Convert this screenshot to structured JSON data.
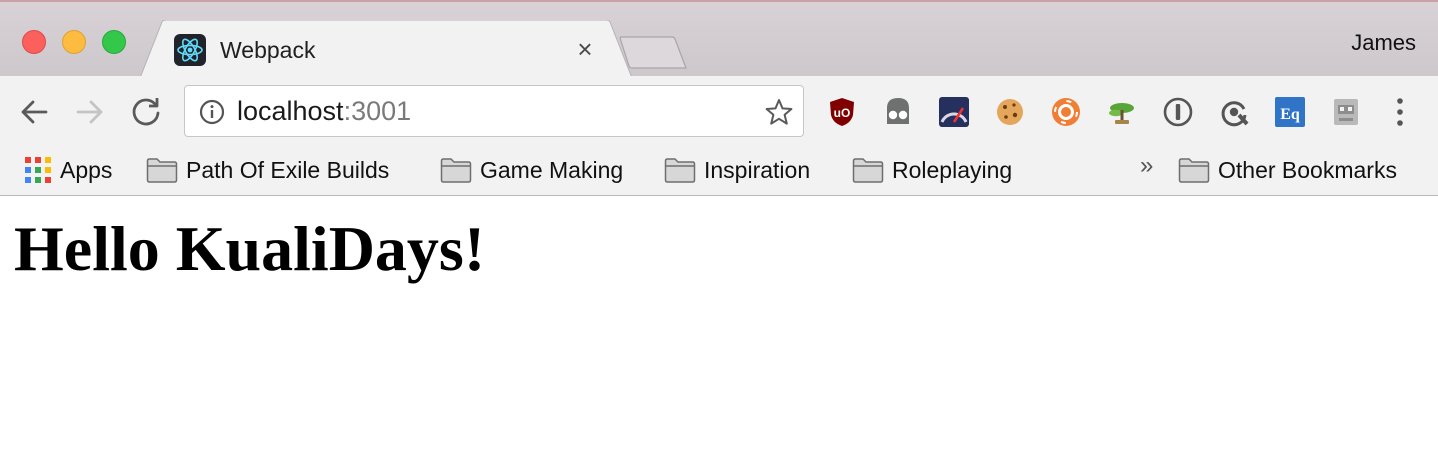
{
  "window": {
    "profile_name": "James"
  },
  "tabs": [
    {
      "title": "Webpack",
      "favicon": "react-logo-icon",
      "close_icon": "×",
      "active": true
    }
  ],
  "toolbar": {
    "url_host": "localhost",
    "url_port": ":3001",
    "extensions": [
      "ublock-origin-icon",
      "ghostery-icon",
      "speed-gauge-icon",
      "cookie-icon",
      "orange-lifebuoy-icon",
      "bonsai-tree-icon",
      "onepassword-icon",
      "refresh-sync-icon",
      "eq-icon",
      "pixel-avatar-icon"
    ]
  },
  "bookmarks": {
    "apps_label": "Apps",
    "folders": [
      "Path Of Exile Builds",
      "Game Making",
      "Inspiration",
      "Roleplaying"
    ],
    "overflow_label": "»",
    "other_label": "Other Bookmarks"
  },
  "page": {
    "heading": "Hello KualiDays!"
  },
  "colors": {
    "close": "#fc605c",
    "minimize": "#fdbc40",
    "maximize": "#34c84a",
    "react": "#61dafb",
    "ublock": "#800000"
  }
}
